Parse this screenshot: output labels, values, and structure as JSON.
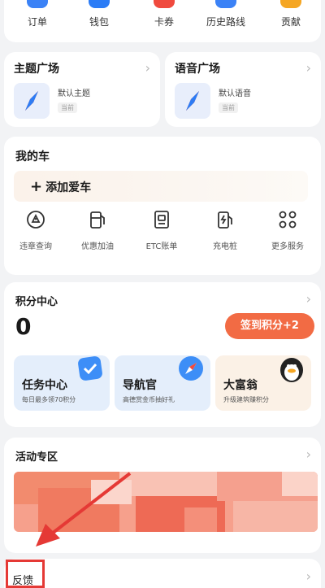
{
  "quick_actions": [
    {
      "label": "订单",
      "icon": "order-icon",
      "color": "#3b82f6"
    },
    {
      "label": "钱包",
      "icon": "wallet-icon",
      "color": "#2b7cf6"
    },
    {
      "label": "卡券",
      "icon": "coupon-icon",
      "color": "#f04a3e"
    },
    {
      "label": "历史路线",
      "icon": "history-route-icon",
      "color": "#3b82f6"
    },
    {
      "label": "贡献",
      "icon": "contribution-icon",
      "color": "#f5a623"
    }
  ],
  "theme_square": {
    "title": "主题广场",
    "item_name": "默认主题",
    "item_tag": "当前"
  },
  "voice_square": {
    "title": "语音广场",
    "item_name": "默认语音",
    "item_tag": "当前"
  },
  "my_car": {
    "title": "我的车",
    "add_label": "添加爱车",
    "services": [
      {
        "label": "违章查询",
        "icon": "violation-query-icon"
      },
      {
        "label": "优惠加油",
        "icon": "fuel-icon"
      },
      {
        "label": "ETC账单",
        "icon": "etc-bill-icon"
      },
      {
        "label": "充电桩",
        "icon": "charging-icon"
      },
      {
        "label": "更多服务",
        "icon": "more-services-icon"
      }
    ]
  },
  "points": {
    "title": "积分中心",
    "value": "0",
    "sign_in_label": "签到积分+2",
    "tasks": [
      {
        "title": "任务中心",
        "subtitle": "每日最多领70积分",
        "icon": "task-check-icon"
      },
      {
        "title": "导航官",
        "subtitle": "高德赏金币抽好礼",
        "icon": "compass-icon"
      },
      {
        "title": "大富翁",
        "subtitle": "升级建筑赚积分",
        "icon": "penguin-icon"
      }
    ]
  },
  "activity": {
    "title": "活动专区"
  },
  "feedback": {
    "label": "反馈"
  },
  "colors": {
    "accent": "#f26b44",
    "highlight_red": "#e53935",
    "background": "#f2f3f5"
  }
}
